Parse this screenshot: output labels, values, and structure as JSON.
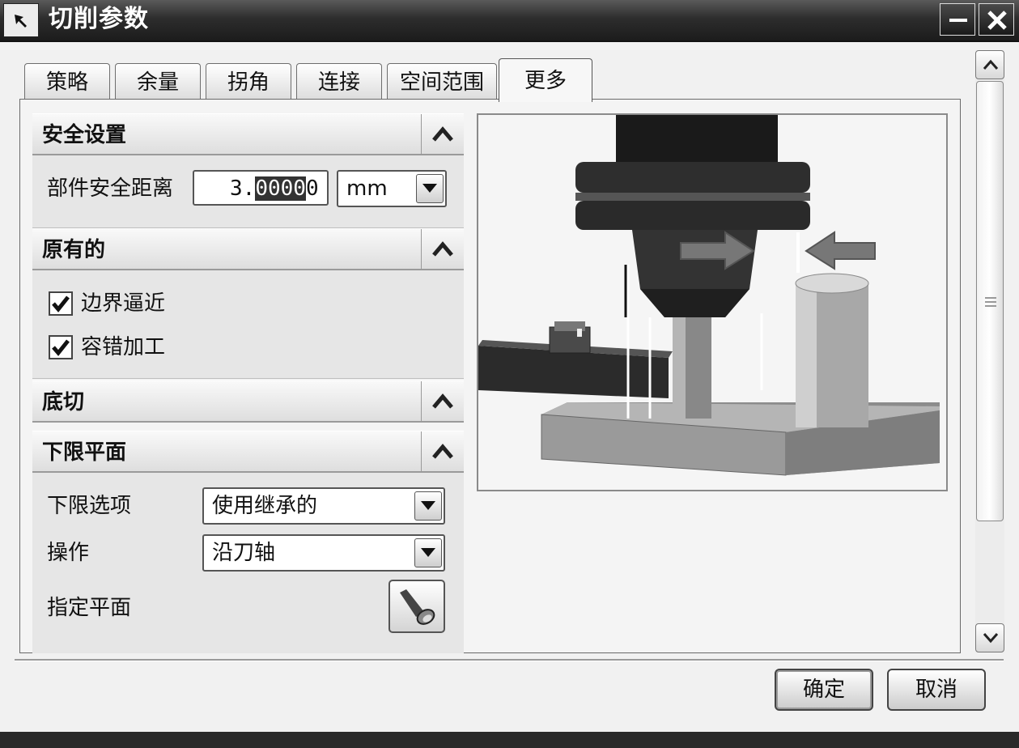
{
  "window": {
    "title": "切削参数",
    "icons": [
      "system-menu-icon",
      "minimize-icon",
      "close-icon"
    ]
  },
  "tabs": [
    {
      "label": "策略",
      "active": false
    },
    {
      "label": "余量",
      "active": false
    },
    {
      "label": "拐角",
      "active": false
    },
    {
      "label": "连接",
      "active": false
    },
    {
      "label": "空间范围",
      "active": false
    },
    {
      "label": "更多",
      "active": true
    }
  ],
  "sections": {
    "safety": {
      "title": "安全设置",
      "part_clearance_label": "部件安全距离",
      "value_plain": "3.",
      "value_selected": "0000",
      "value_tail": "0",
      "unit": "mm"
    },
    "original": {
      "title": "原有的",
      "boundary_approach": {
        "label": "边界逼近",
        "checked": true
      },
      "tolerant_machining": {
        "label": "容错加工",
        "checked": true
      }
    },
    "undercut": {
      "title": "底切"
    },
    "lower_limit_plane": {
      "title": "下限平面",
      "option_label": "下限选项",
      "option_value": "使用继承的",
      "operation_label": "操作",
      "operation_value": "沿刀轴",
      "specify_plane_label": "指定平面"
    }
  },
  "buttons": {
    "ok": "确定",
    "cancel": "取消"
  }
}
